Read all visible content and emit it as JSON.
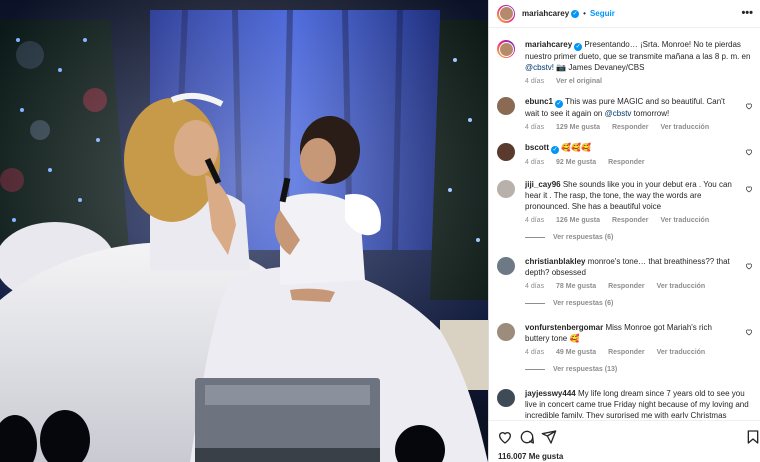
{
  "header": {
    "username": "mariahcarey",
    "follow_label": "Seguir",
    "more_label": "•••"
  },
  "caption": {
    "username": "mariahcarey",
    "text": "Presentando… ¡Srta. Monroe! No te pierdas nuestro primer dueto, que se transmite mañana a las 8 p. m. en",
    "mention": "@cbstv!",
    "credit": "📷 James Devaney/CBS",
    "time": "4 días",
    "translation": "Ver el original"
  },
  "comments": [
    {
      "username": "ebunc1",
      "verified": true,
      "text": "This was pure MAGIC and so beautiful. Can't wait to see it again on",
      "mention": "@cbstv",
      "text_after": "tomorrow!",
      "time": "4 días",
      "likes": "129 Me gusta",
      "reply": "Responder",
      "translate": "Ver traducción",
      "avatar_color": "#8a6a52"
    },
    {
      "username": "bscott",
      "verified": true,
      "text": "🥰🥰🥰",
      "time": "4 días",
      "likes": "92 Me gusta",
      "reply": "Responder",
      "avatar_color": "#5a3a2c"
    },
    {
      "username": "jiji_cay96",
      "verified": false,
      "text": "She sounds like you in your debut era . You can hear it . The rasp, the tone, the way the words are pronounced. She has a beautiful voice",
      "time": "4 días",
      "likes": "126 Me gusta",
      "reply": "Responder",
      "translate": "Ver traducción",
      "replies": "Ver respuestas (6)",
      "avatar_color": "#b8b0aa"
    },
    {
      "username": "christianblakley",
      "verified": false,
      "text": "monroe's tone… that breathiness?? that depth? obsessed",
      "time": "4 días",
      "likes": "78 Me gusta",
      "reply": "Responder",
      "translate": "Ver traducción",
      "replies": "Ver respuestas (6)",
      "avatar_color": "#6d7a86"
    },
    {
      "username": "vonfurstenbergomar",
      "verified": false,
      "text": "Miss Monroe got Mariah's rich buttery tone 🥰",
      "time": "4 días",
      "likes": "49 Me gusta",
      "reply": "Responder",
      "translate": "Ver traducción",
      "replies": "Ver respuestas (13)",
      "avatar_color": "#9c8c7c"
    },
    {
      "username": "jayjesswy444",
      "verified": false,
      "text": "My life long dream since 7 years old to see you live in concert came true Friday night because of my loving and incredible family. They surprised me with early Christmas",
      "avatar_color": "#3f4a57"
    }
  ],
  "footer": {
    "likes": "116.007 Me gusta"
  },
  "icons": {
    "heart": "heart-icon",
    "comment": "comment-icon",
    "share": "share-icon",
    "save": "bookmark-icon"
  },
  "colors": {
    "accent": "#0095f6",
    "muted": "#8e8e8e",
    "stage_blue": "#1f3aa8"
  }
}
